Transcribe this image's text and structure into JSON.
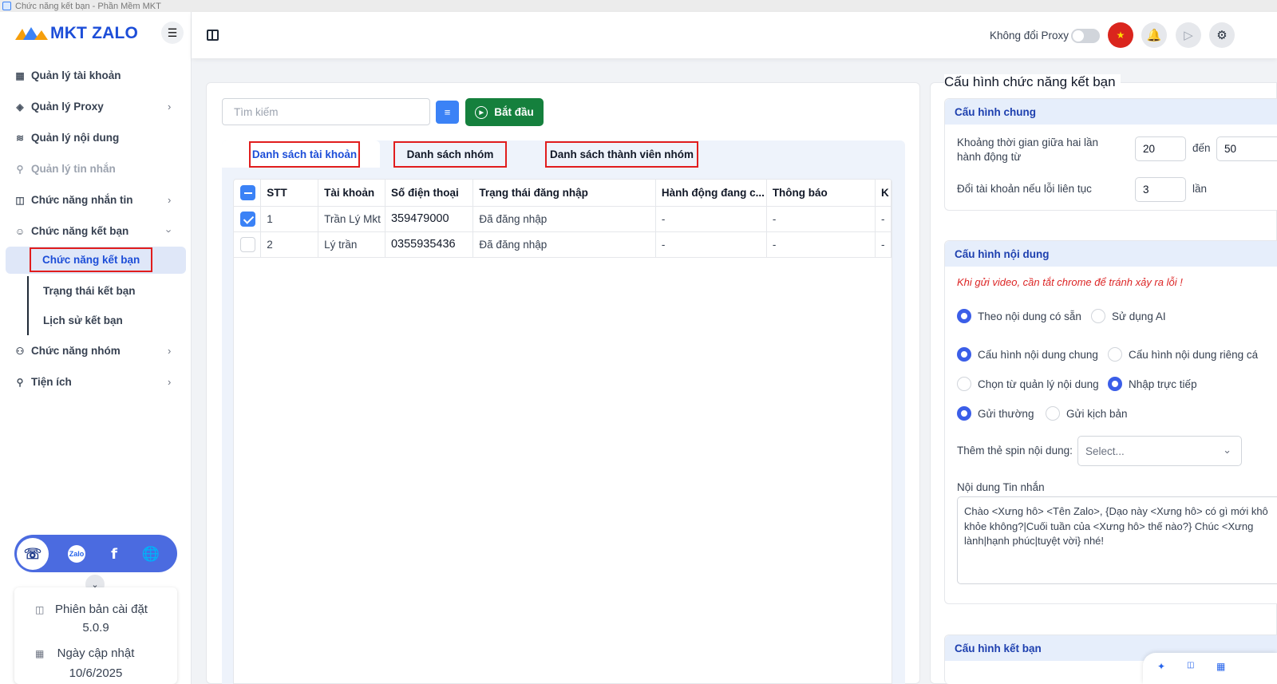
{
  "window": {
    "title": "Chức năng kết bạn - Phần Mềm MKT"
  },
  "sidebar": {
    "logo": "MKT ZALO",
    "items": [
      {
        "label": "Quản lý tài khoản",
        "icon": "dashboard-icon"
      },
      {
        "label": "Quản lý Proxy",
        "icon": "layers-icon"
      },
      {
        "label": "Quản lý nội dung",
        "icon": "content-icon"
      },
      {
        "label": "Quản lý tin nhắn",
        "icon": "search-icon"
      },
      {
        "label": "Chức năng nhắn tin",
        "icon": "message-icon"
      },
      {
        "label": "Chức năng kết bạn",
        "icon": "add-user-icon"
      },
      {
        "label": "Chức năng nhóm",
        "icon": "group-icon"
      },
      {
        "label": "Tiện ích",
        "icon": "search-icon"
      }
    ],
    "subitems": [
      {
        "label": "Chức năng kết bạn"
      },
      {
        "label": "Trạng thái kết bạn"
      },
      {
        "label": "Lịch sử kết bạn"
      }
    ],
    "social": [
      "support-icon",
      "zalo-icon",
      "facebook-icon",
      "globe-icon"
    ],
    "zalo_text": "Zalo",
    "version_label": "Phiên bản cài đặt",
    "version_value": "5.0.9",
    "update_label": "Ngày cập nhật",
    "update_value": "10/6/2025"
  },
  "header": {
    "proxy_label": "Không đổi Proxy",
    "proxy_toggle": false
  },
  "main": {
    "search_placeholder": "Tìm kiếm",
    "start_label": "Bắt đầu",
    "tabs": [
      {
        "label": "Danh sách tài khoản",
        "active": true
      },
      {
        "label": "Danh sách nhóm",
        "active": false
      },
      {
        "label": "Danh sách thành viên nhóm",
        "active": false
      }
    ],
    "table": {
      "columns": [
        "STT",
        "Tài khoản",
        "Số điện thoại",
        "Trạng thái đăng nhập",
        "Hành động đang c...",
        "Thông báo",
        "K"
      ],
      "rows": [
        {
          "checked": true,
          "cells": [
            "1",
            "Trần Lý Mkt",
            "359479000",
            "Đã đăng nhập",
            "-",
            "-",
            "-"
          ]
        },
        {
          "checked": false,
          "cells": [
            "2",
            "Lý trần",
            "0355935436",
            "Đã đăng nhập",
            "-",
            "-",
            "-"
          ]
        }
      ]
    }
  },
  "config": {
    "title": "Cấu hình chức năng kết bạn",
    "general": {
      "head": "Cấu hình chung",
      "interval_label": "Khoảng thời gian giữa hai lần hành động từ",
      "interval_from": "20",
      "to_label": "đến",
      "interval_to": "50",
      "switch_label": "Đổi tài khoản nếu lỗi liên tục",
      "switch_value": "3",
      "times_label": "lần"
    },
    "content": {
      "head": "Cấu hình nội dung",
      "warning": "Khi gửi video, cần tắt chrome để tránh xảy ra lỗi !",
      "radio_source": [
        {
          "label": "Theo nội dung có sẵn",
          "checked": true
        },
        {
          "label": "Sử dụng AI",
          "checked": false
        }
      ],
      "radio_scope": [
        {
          "label": "Cấu hình nội dung chung",
          "checked": true
        },
        {
          "label": "Cấu hình nội dung riêng cá",
          "checked": false
        }
      ],
      "radio_input": [
        {
          "label": "Chọn từ quản lý nội dung",
          "checked": false
        },
        {
          "label": "Nhập trực tiếp",
          "checked": true
        }
      ],
      "radio_send": [
        {
          "label": "Gửi thường",
          "checked": true
        },
        {
          "label": "Gửi kịch bản",
          "checked": false
        }
      ],
      "spin_label": "Thêm thẻ spin nội dung:",
      "spin_placeholder": "Select...",
      "message_label": "Nội dung Tin nhắn",
      "message_value": "Chào <Xưng hô> <Tên Zalo>, {Dạo này <Xưng hô> có gì mới khô\nkhỏe không?|Cuối tuần của <Xưng hô> thế nào?} Chúc <Xưng\nlành|hạnh phúc|tuyệt vời} nhé!"
    },
    "friend": {
      "head": "Cấu hình kết bạn"
    }
  },
  "colors": {
    "accent": "#3b82f6",
    "start": "#15803d",
    "highlight": "#e11d1d",
    "warn": "#dc2626"
  }
}
